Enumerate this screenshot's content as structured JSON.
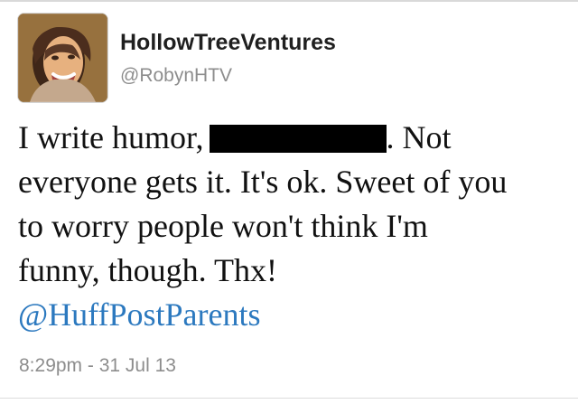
{
  "tweet": {
    "display_name": "HollowTreeVentures",
    "handle": "@RobynHTV",
    "text": {
      "line1_before": "I write humor,",
      "line1_after": ". Not",
      "line2": "everyone gets it. It's ok. Sweet of you",
      "line3": "to worry people won't think I'm",
      "line4": "funny, though. Thx!",
      "mention": "@HuffPostParents"
    },
    "timestamp": "8:29pm - 31 Jul 13"
  },
  "colors": {
    "mention": "#2c79bf",
    "meta_text": "#8d8d8d",
    "redaction": "#000000"
  },
  "icons": {
    "avatar": "profile-photo"
  }
}
